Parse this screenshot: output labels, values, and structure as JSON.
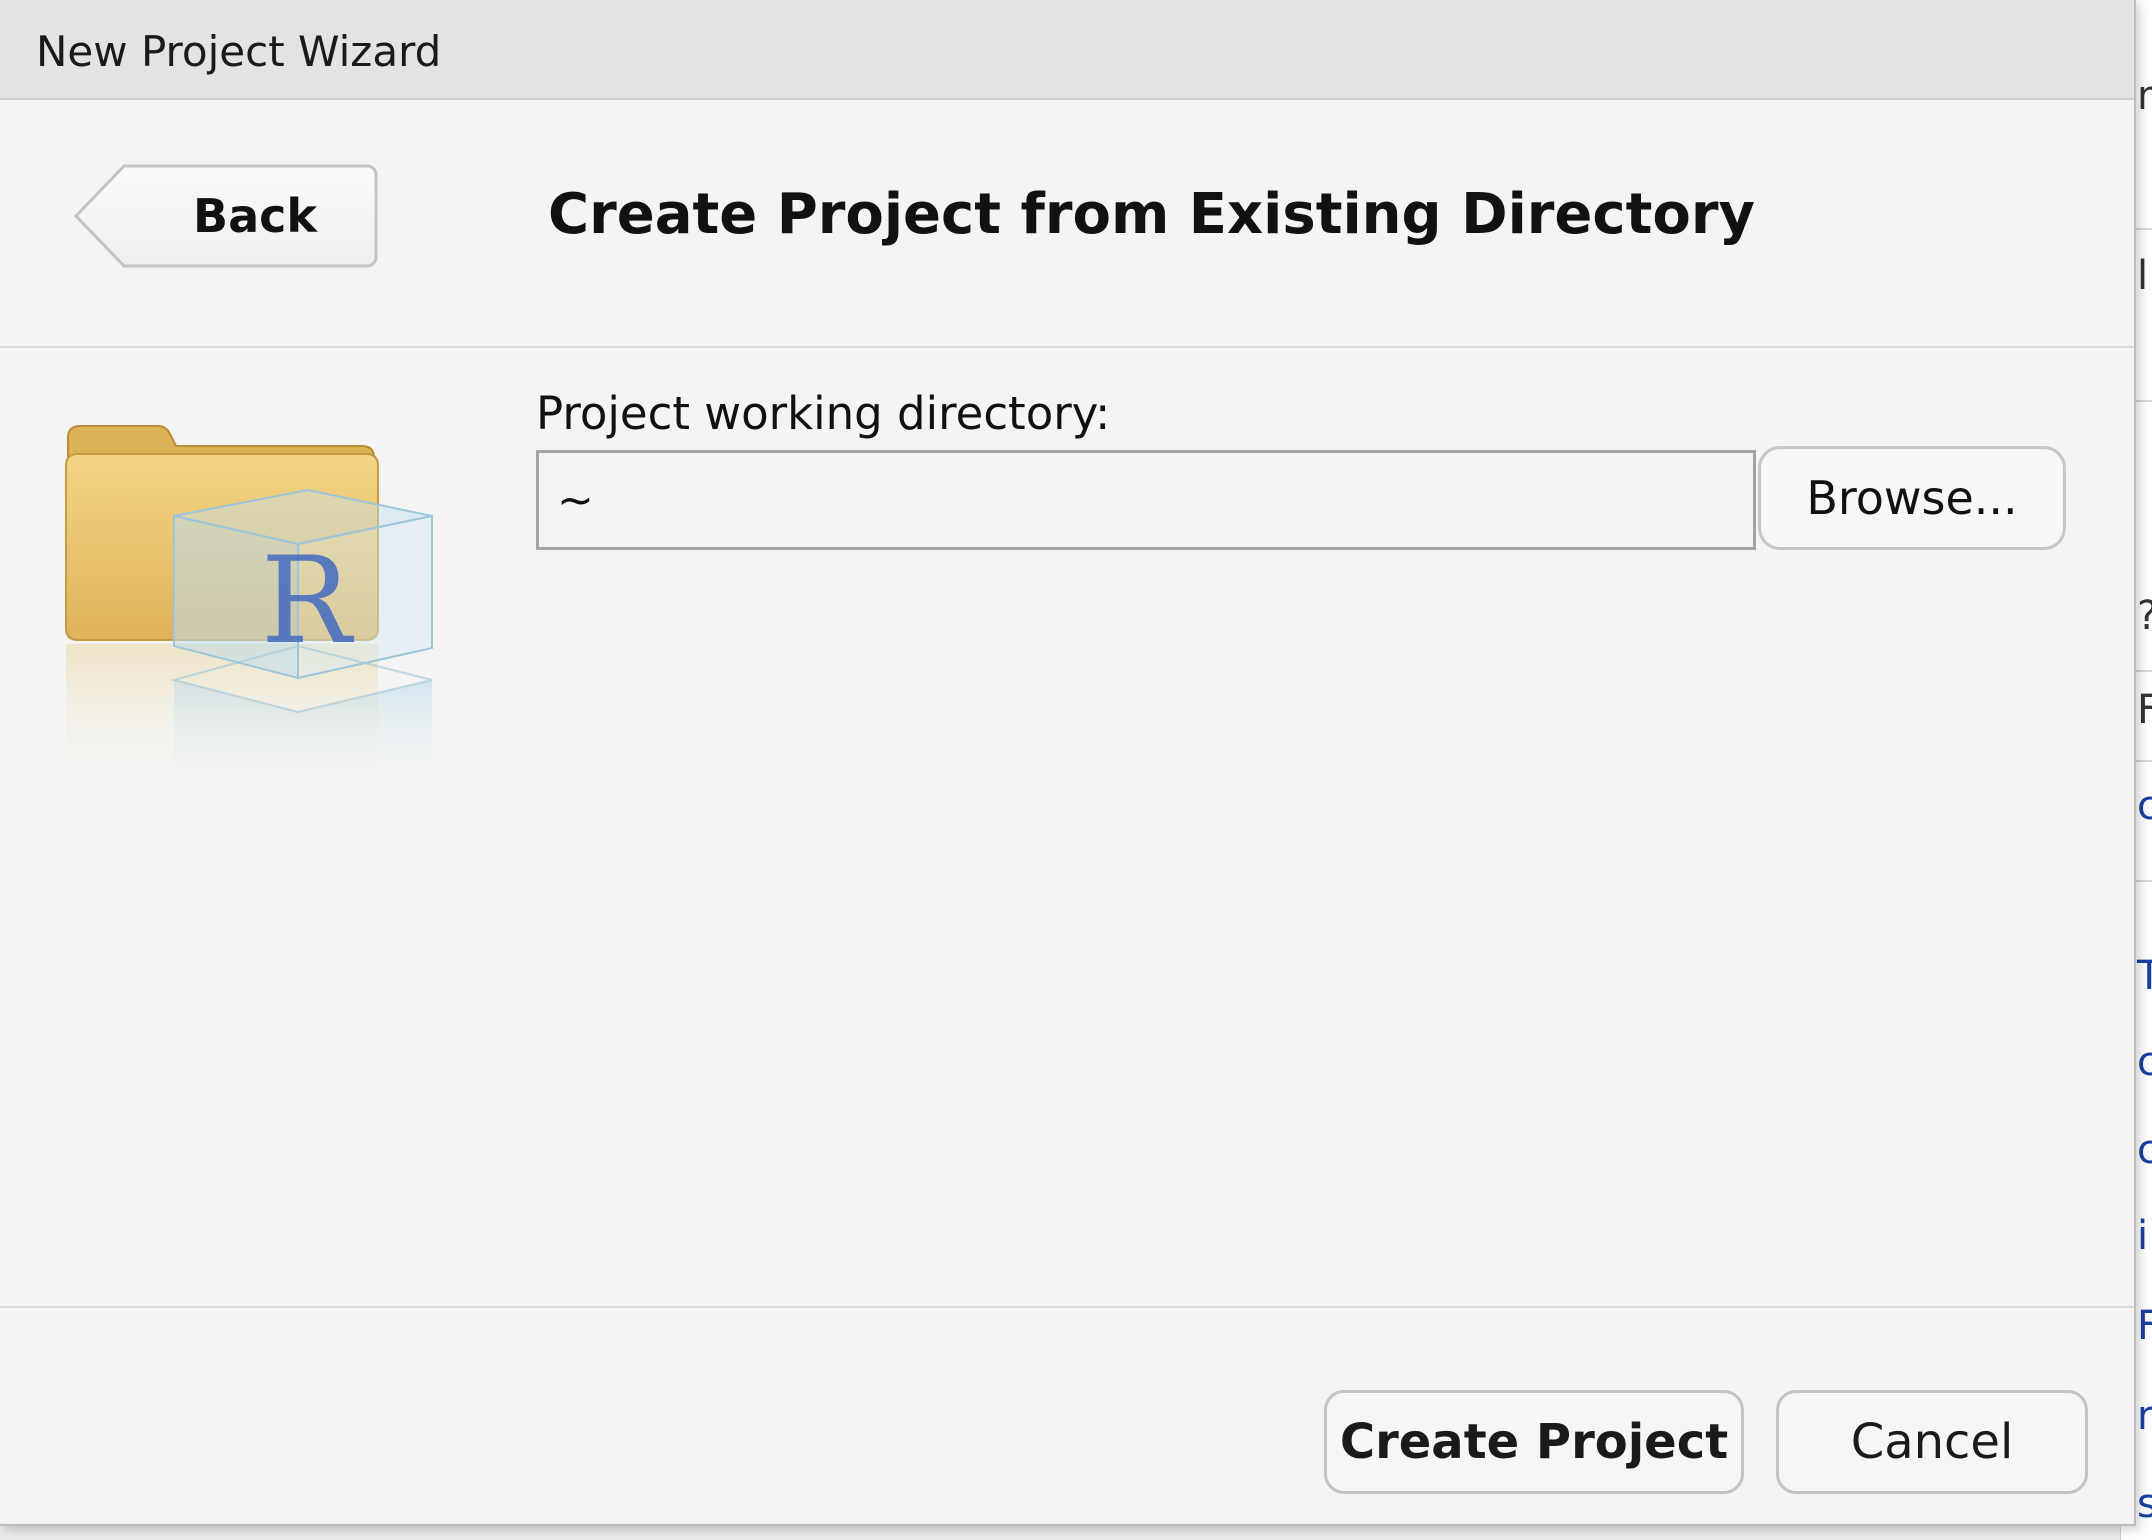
{
  "window": {
    "title": "New Project Wizard"
  },
  "header": {
    "back_label": "Back",
    "heading": "Create Project from Existing Directory"
  },
  "form": {
    "directory_label": "Project working directory:",
    "directory_value": "~",
    "browse_label": "Browse..."
  },
  "footer": {
    "create_label": "Create Project",
    "cancel_label": "Cancel"
  },
  "icons": {
    "project_icon": "r-project-folder-icon",
    "project_icon_letter": "R"
  },
  "colors": {
    "dialog_background": "#f3f4f3",
    "titlebar_background": "#e2e3e5",
    "folder_tan": "#e7c46a",
    "r_logo_blue": "#4a6fbf"
  }
}
